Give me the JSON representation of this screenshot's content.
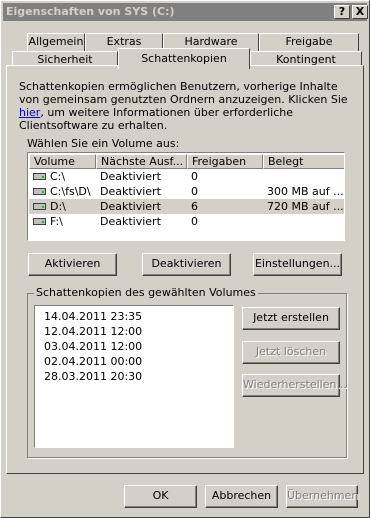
{
  "window": {
    "title": "Eigenschaften von SYS (C:)",
    "help_label": "?",
    "close_label": "X"
  },
  "tabs": {
    "row1": [
      "Allgemein",
      "Extras",
      "Hardware",
      "Freigabe"
    ],
    "row2": [
      "Sicherheit",
      "Schattenkopien",
      "Kontingent"
    ]
  },
  "description": {
    "before_link": "Schattenkopien ermöglichen Benutzern, vorherige Inhalte von gemeinsam genutzten Ordnern anzuzeigen. Klicken Sie ",
    "link": "hier",
    "after_link": ", um weitere Informationen über erforderliche Clientsoftware zu erhalten."
  },
  "volume_select": {
    "label": "Wählen Sie ein Volume aus:"
  },
  "volume_table": {
    "headers": [
      "Volume",
      "Nächste Ausf...",
      "Freigaben",
      "Belegt"
    ],
    "rows": [
      {
        "volume": "C:\\",
        "next": "Deaktiviert",
        "shares": "0",
        "used": ""
      },
      {
        "volume": "C:\\fs\\D\\",
        "next": "Deaktiviert",
        "shares": "0",
        "used": "300 MB auf ..."
      },
      {
        "volume": "D:\\",
        "next": "Deaktiviert",
        "shares": "6",
        "used": "720 MB auf ..."
      },
      {
        "volume": "F:\\",
        "next": "Deaktiviert",
        "shares": "0",
        "used": ""
      }
    ],
    "icon": "drive-icon"
  },
  "buttons": {
    "activate": "Aktivieren",
    "deactivate": "Deaktivieren",
    "settings": "Einstellungen...",
    "create_now": "Jetzt erstellen",
    "delete_now": "Jetzt löschen",
    "restore": "Wiederherstellen...",
    "ok": "OK",
    "cancel": "Abbrechen",
    "apply": "Übernehmen"
  },
  "shadow_copies": {
    "group_title": "Schattenkopien des gewählten Volumes",
    "items": [
      "14.04.2011 23:35",
      "12.04.2011 12:00",
      "03.04.2011 12:00",
      "02.04.2011 00:00",
      "28.03.2011 20:30"
    ]
  }
}
